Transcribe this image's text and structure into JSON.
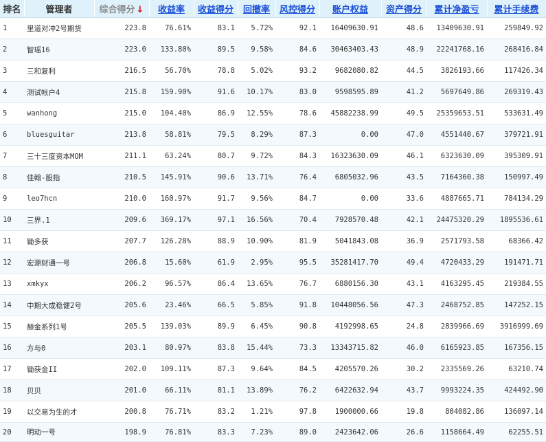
{
  "columns": {
    "rank": "排名",
    "manager": "管理者",
    "composite": "综合得分",
    "sort_arrow": "↓",
    "return_rate": "收益率",
    "return_score": "收益得分",
    "drawdown": "回撤率",
    "risk_score": "风控得分",
    "equity": "账户权益",
    "asset_score": "资产得分",
    "cum_pnl": "累计净盈亏",
    "cum_fee": "累计手续费"
  },
  "colors": {
    "header_bg": "#dff1fa",
    "link": "#1a4fd6",
    "pnl": "#e00000",
    "sort_arrow": "#e60000"
  },
  "rows": [
    {
      "rank": "1",
      "manager": "里道对冲2号期货",
      "composite": "223.8",
      "return_rate": "76.61%",
      "return_score": "83.1",
      "drawdown": "5.72%",
      "risk_score": "92.1",
      "equity": "16409630.91",
      "asset_score": "48.6",
      "cum_pnl": "13409630.91",
      "cum_fee": "259849.92"
    },
    {
      "rank": "2",
      "manager": "智瑶16",
      "composite": "223.0",
      "return_rate": "133.80%",
      "return_score": "89.5",
      "drawdown": "9.58%",
      "risk_score": "84.6",
      "equity": "30463403.43",
      "asset_score": "48.9",
      "cum_pnl": "22241768.16",
      "cum_fee": "268416.84"
    },
    {
      "rank": "3",
      "manager": "三和复利",
      "composite": "216.5",
      "return_rate": "56.70%",
      "return_score": "78.8",
      "drawdown": "5.02%",
      "risk_score": "93.2",
      "equity": "9682080.82",
      "asset_score": "44.5",
      "cum_pnl": "3826193.66",
      "cum_fee": "117426.34"
    },
    {
      "rank": "4",
      "manager": "测试帐户4",
      "composite": "215.8",
      "return_rate": "159.90%",
      "return_score": "91.6",
      "drawdown": "10.17%",
      "risk_score": "83.0",
      "equity": "9598595.89",
      "asset_score": "41.2",
      "cum_pnl": "5697649.86",
      "cum_fee": "269319.43"
    },
    {
      "rank": "5",
      "manager": "wanhong",
      "composite": "215.0",
      "return_rate": "104.40%",
      "return_score": "86.9",
      "drawdown": "12.55%",
      "risk_score": "78.6",
      "equity": "45882238.99",
      "asset_score": "49.5",
      "cum_pnl": "25359653.51",
      "cum_fee": "533631.49"
    },
    {
      "rank": "6",
      "manager": "bluesguitar",
      "composite": "213.8",
      "return_rate": "58.81%",
      "return_score": "79.5",
      "drawdown": "8.29%",
      "risk_score": "87.3",
      "equity": "0.00",
      "asset_score": "47.0",
      "cum_pnl": "4551440.67",
      "cum_fee": "379721.91"
    },
    {
      "rank": "7",
      "manager": "三十三度资本MOM",
      "composite": "211.1",
      "return_rate": "63.24%",
      "return_score": "80.7",
      "drawdown": "9.72%",
      "risk_score": "84.3",
      "equity": "16323630.09",
      "asset_score": "46.1",
      "cum_pnl": "6323630.09",
      "cum_fee": "395309.91"
    },
    {
      "rank": "8",
      "manager": "佳翰-股指",
      "composite": "210.5",
      "return_rate": "145.91%",
      "return_score": "90.6",
      "drawdown": "13.71%",
      "risk_score": "76.4",
      "equity": "6805032.96",
      "asset_score": "43.5",
      "cum_pnl": "7164360.38",
      "cum_fee": "150997.49"
    },
    {
      "rank": "9",
      "manager": "leo7hcn",
      "composite": "210.0",
      "return_rate": "160.97%",
      "return_score": "91.7",
      "drawdown": "9.56%",
      "risk_score": "84.7",
      "equity": "0.00",
      "asset_score": "33.6",
      "cum_pnl": "4887665.71",
      "cum_fee": "784134.29"
    },
    {
      "rank": "10",
      "manager": "三界.1",
      "composite": "209.6",
      "return_rate": "369.17%",
      "return_score": "97.1",
      "drawdown": "16.56%",
      "risk_score": "70.4",
      "equity": "7928570.48",
      "asset_score": "42.1",
      "cum_pnl": "24475320.29",
      "cum_fee": "1895536.61"
    },
    {
      "rank": "11",
      "manager": "锄多获",
      "composite": "207.7",
      "return_rate": "126.28%",
      "return_score": "88.9",
      "drawdown": "10.90%",
      "risk_score": "81.9",
      "equity": "5041843.08",
      "asset_score": "36.9",
      "cum_pnl": "2571793.58",
      "cum_fee": "68366.42"
    },
    {
      "rank": "12",
      "manager": "宏源财通一号",
      "composite": "206.8",
      "return_rate": "15.60%",
      "return_score": "61.9",
      "drawdown": "2.95%",
      "risk_score": "95.5",
      "equity": "35281417.70",
      "asset_score": "49.4",
      "cum_pnl": "4720433.29",
      "cum_fee": "191471.71"
    },
    {
      "rank": "13",
      "manager": "xmkyx",
      "composite": "206.2",
      "return_rate": "96.57%",
      "return_score": "86.4",
      "drawdown": "13.65%",
      "risk_score": "76.7",
      "equity": "6880156.30",
      "asset_score": "43.1",
      "cum_pnl": "4163295.45",
      "cum_fee": "219384.55"
    },
    {
      "rank": "14",
      "manager": "中期大成稳健2号",
      "composite": "205.6",
      "return_rate": "23.46%",
      "return_score": "66.5",
      "drawdown": "5.85%",
      "risk_score": "91.8",
      "equity": "10448056.56",
      "asset_score": "47.3",
      "cum_pnl": "2468752.85",
      "cum_fee": "147252.15"
    },
    {
      "rank": "15",
      "manager": "赫金系列1号",
      "composite": "205.5",
      "return_rate": "139.03%",
      "return_score": "89.9",
      "drawdown": "6.45%",
      "risk_score": "90.8",
      "equity": "4192998.65",
      "asset_score": "24.8",
      "cum_pnl": "2839966.69",
      "cum_fee": "3916999.69"
    },
    {
      "rank": "16",
      "manager": "方与0",
      "composite": "203.1",
      "return_rate": "80.97%",
      "return_score": "83.8",
      "drawdown": "15.44%",
      "risk_score": "73.3",
      "equity": "13343715.82",
      "asset_score": "46.0",
      "cum_pnl": "6165923.85",
      "cum_fee": "167356.15"
    },
    {
      "rank": "17",
      "manager": "锄获金II",
      "composite": "202.0",
      "return_rate": "109.11%",
      "return_score": "87.3",
      "drawdown": "9.64%",
      "risk_score": "84.5",
      "equity": "4205570.26",
      "asset_score": "30.2",
      "cum_pnl": "2335569.26",
      "cum_fee": "63210.74"
    },
    {
      "rank": "18",
      "manager": "贝贝",
      "composite": "201.0",
      "return_rate": "66.11%",
      "return_score": "81.1",
      "drawdown": "13.89%",
      "risk_score": "76.2",
      "equity": "6422632.94",
      "asset_score": "43.7",
      "cum_pnl": "9993224.35",
      "cum_fee": "424492.90"
    },
    {
      "rank": "19",
      "manager": "以交易为生的才",
      "composite": "200.8",
      "return_rate": "76.71%",
      "return_score": "83.2",
      "drawdown": "1.21%",
      "risk_score": "97.8",
      "equity": "1900000.66",
      "asset_score": "19.8",
      "cum_pnl": "804082.86",
      "cum_fee": "136097.14"
    },
    {
      "rank": "20",
      "manager": "明动一号",
      "composite": "198.9",
      "return_rate": "76.81%",
      "return_score": "83.3",
      "drawdown": "7.23%",
      "risk_score": "89.0",
      "equity": "2423642.06",
      "asset_score": "26.6",
      "cum_pnl": "1158664.49",
      "cum_fee": "62255.51"
    }
  ]
}
